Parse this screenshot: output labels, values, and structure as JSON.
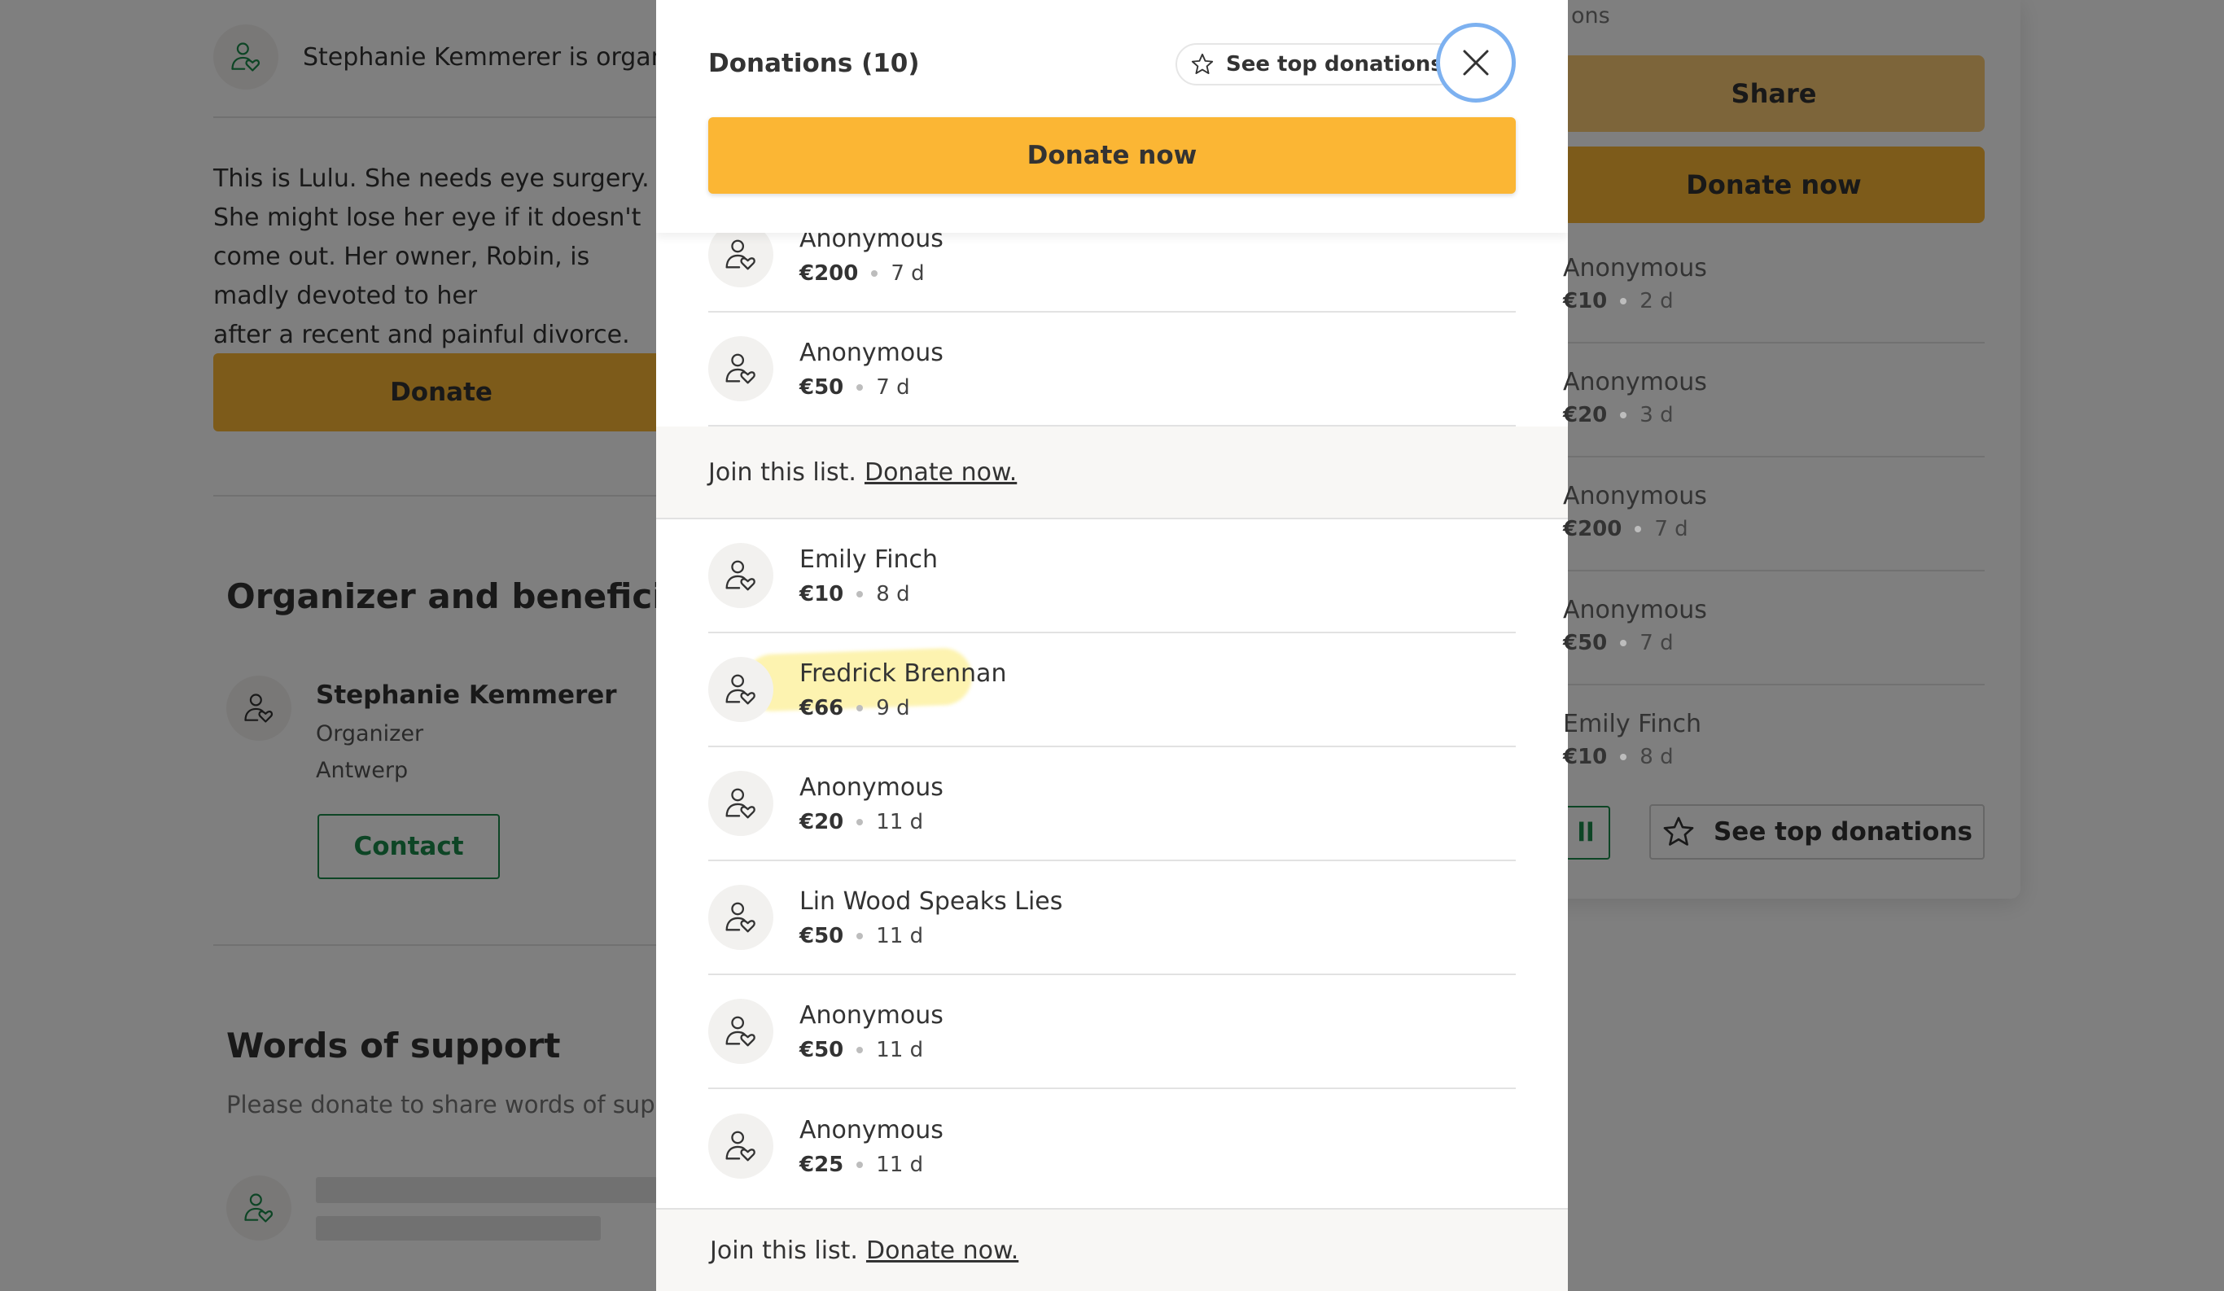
{
  "page": {
    "organizer_strip_text": "Stephanie Kemmerer is organizing this fundraiser",
    "story": "This is Lulu. She needs eye surgery. She might lose her eye if it doesn't\ncome out. Her owner, Robin, is madly devoted to her\nafter a recent and painful divorce.",
    "donate_label": "Donate",
    "organizer_section_title": "Organizer and beneficiary",
    "organizer": {
      "name": "Stephanie Kemmerer",
      "role": "Organizer",
      "city": "Antwerp"
    },
    "contact_label": "Contact",
    "support_title": "Words of support",
    "support_subtitle": "Please donate to share words of support."
  },
  "sidebar": {
    "top_label": "ons",
    "share_label": "Share",
    "donate_label": "Donate now",
    "donations": [
      {
        "name": "Anonymous",
        "amount": "€10",
        "time": "2 d"
      },
      {
        "name": "Anonymous",
        "amount": "€20",
        "time": "3 d"
      },
      {
        "name": "Anonymous",
        "amount": "€200",
        "time": "7 d"
      },
      {
        "name": "Anonymous",
        "amount": "€50",
        "time": "7 d"
      },
      {
        "name": "Emily Finch",
        "amount": "€10",
        "time": "8 d"
      }
    ],
    "see_all_label": "ll",
    "see_top_label": "See top donations"
  },
  "modal": {
    "title": "Donations (10)",
    "see_top_label": "See top donations",
    "donate_label": "Donate now",
    "join_text": "Join this list.",
    "join_link": "Donate now.",
    "donations_top": [
      {
        "name": "Anonymous",
        "amount": "€200",
        "time": "7 d"
      },
      {
        "name": "Anonymous",
        "amount": "€50",
        "time": "7 d"
      }
    ],
    "donations_bottom": [
      {
        "name": "Emily Finch",
        "amount": "€10",
        "time": "8 d"
      },
      {
        "name": "Fredrick Brennan",
        "amount": "€66",
        "time": "9 d",
        "highlighted": true
      },
      {
        "name": "Anonymous",
        "amount": "€20",
        "time": "11 d"
      },
      {
        "name": "Lin Wood Speaks Lies",
        "amount": "€50",
        "time": "11 d"
      },
      {
        "name": "Anonymous",
        "amount": "€50",
        "time": "11 d"
      },
      {
        "name": "Anonymous",
        "amount": "€25",
        "time": "11 d"
      }
    ]
  },
  "colors": {
    "accent_yellow": "#fbb634",
    "brand_green": "#1b8a4a",
    "focus_ring": "#7db1f0",
    "highlight": "#fdf3b0"
  },
  "icons": {
    "donor": "donor-heart-icon",
    "star": "star-icon",
    "close": "close-icon"
  }
}
